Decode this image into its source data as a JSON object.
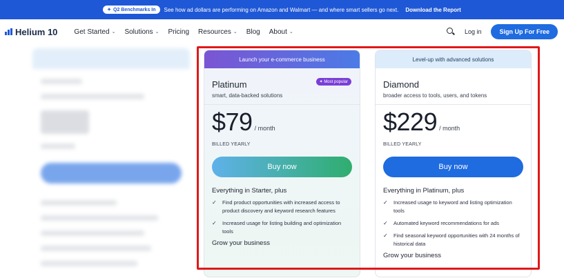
{
  "announcement": {
    "pill_label": "Q2 Benchmarks In",
    "text": "See how ad dollars are performing on Amazon and Walmart — and where smart sellers go next.",
    "link": "Download the Report"
  },
  "nav": {
    "logo_text": "Helium 10",
    "items": [
      {
        "label": "Get Started",
        "dropdown": true
      },
      {
        "label": "Solutions",
        "dropdown": true
      },
      {
        "label": "Pricing",
        "dropdown": false
      },
      {
        "label": "Resources",
        "dropdown": true
      },
      {
        "label": "Blog",
        "dropdown": false
      },
      {
        "label": "About",
        "dropdown": true
      }
    ],
    "login": "Log in",
    "signup": "Sign Up For Free"
  },
  "plans": [
    {
      "header": "Launch your e-commerce business",
      "name": "Platinum",
      "badge": "Most popular",
      "subtitle": "smart, data-backed solutions",
      "price": "$79",
      "period": "/ month",
      "billing": "BILLED YEARLY",
      "cta": "Buy now",
      "includes": "Everything in Starter, plus",
      "features": [
        "Find product opportunities with increased access to product discovery and keyword research features",
        "Increased usage for listing building and optimization tools"
      ],
      "section2": "Grow your business"
    },
    {
      "header": "Level-up with advanced solutions",
      "name": "Diamond",
      "subtitle": "broader access to tools, users, and tokens",
      "price": "$229",
      "period": "/ month",
      "billing": "BILLED YEARLY",
      "cta": "Buy now",
      "includes": "Everything in Platinum, plus",
      "features": [
        "Increased usage to keyword and listing optimization tools",
        "Automated keyword recommendations for ads",
        "Find seasonal keyword opportunities with 24 months of historical data"
      ],
      "section2": "Grow your business"
    }
  ],
  "colors": {
    "brand_blue": "#1f6be0",
    "highlight_red": "#e01818",
    "badge_purple": "#7a3fd6"
  }
}
